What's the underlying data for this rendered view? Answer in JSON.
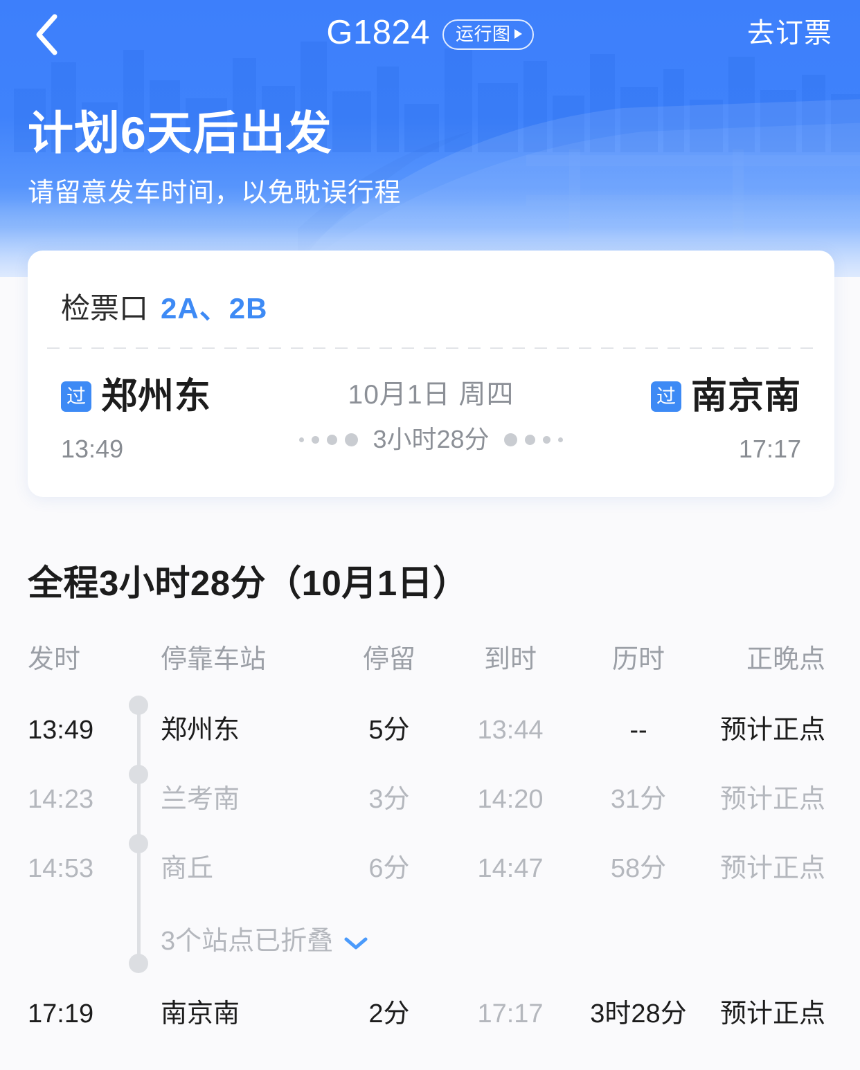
{
  "colors": {
    "brand_blue": "#3d7ffb",
    "accent_blue": "#3d8af5",
    "text_dark": "#1c1c1c",
    "text_muted": "#b4b7bd",
    "page_bg": "#fafafc"
  },
  "navbar": {
    "back_icon": "chevron-left-icon",
    "train_number": "G1824",
    "chart_pill_label": "运行图",
    "chart_pill_icon": "play-triangle-icon",
    "book_label": "去订票"
  },
  "hero": {
    "headline": "计划6天后出发",
    "subline": "请留意发车时间，以免耽误行程"
  },
  "card": {
    "gate_label": "检票口",
    "gate_value": "2A、2B",
    "departure": {
      "badge": "过",
      "station": "郑州东",
      "time": "13:49"
    },
    "arrival": {
      "badge": "过",
      "station": "南京南",
      "time": "17:17"
    },
    "date": "10月1日 周四",
    "duration": "3小时28分"
  },
  "schedule": {
    "title": "全程3小时28分（10月1日）",
    "headers": [
      "发时",
      "停靠车站",
      "停留",
      "到时",
      "历时",
      "正晚点"
    ],
    "rows": [
      {
        "depart": "13:49",
        "station": "郑州东",
        "stop": "5分",
        "arrive": "13:44",
        "elapsed": "--",
        "punctuality": "预计正点",
        "style": "strong"
      },
      {
        "depart": "14:23",
        "station": "兰考南",
        "stop": "3分",
        "arrive": "14:20",
        "elapsed": "31分",
        "punctuality": "预计正点",
        "style": "muted"
      },
      {
        "depart": "14:53",
        "station": "商丘",
        "stop": "6分",
        "arrive": "14:47",
        "elapsed": "58分",
        "punctuality": "预计正点",
        "style": "muted"
      }
    ],
    "collapsed": {
      "label": "3个站点已折叠",
      "icon": "chevron-down-icon"
    },
    "final_row": {
      "depart": "17:19",
      "station": "南京南",
      "stop": "2分",
      "arrive": "17:17",
      "elapsed": "3时28分",
      "punctuality": "预计正点",
      "style": "strong"
    }
  }
}
